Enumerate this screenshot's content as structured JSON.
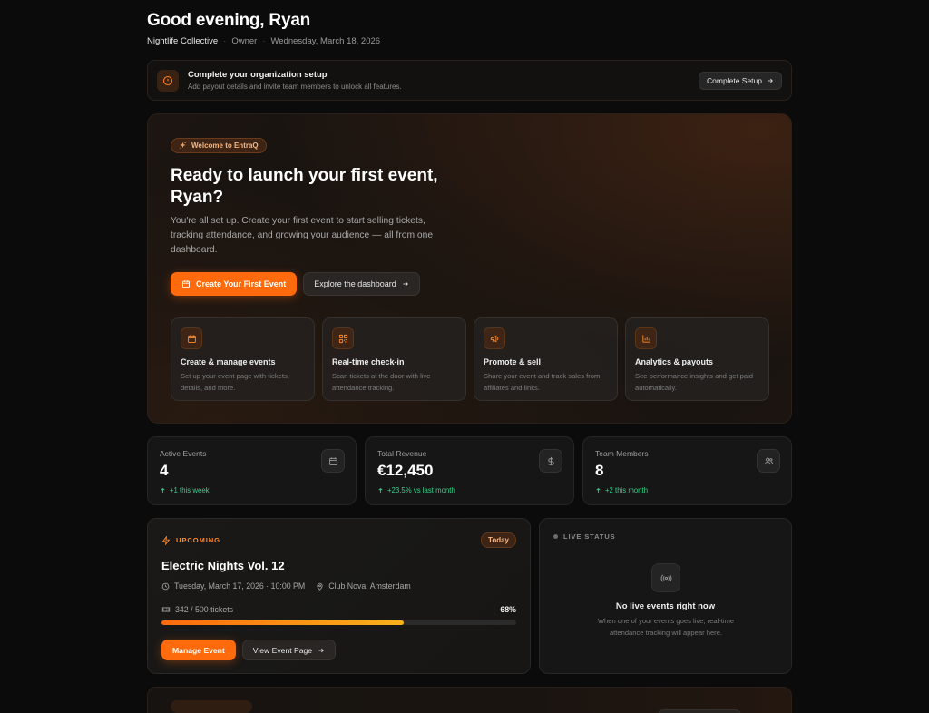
{
  "header": {
    "greeting": "Good evening, Ryan",
    "org": "Nightlife Collective",
    "role": "Owner",
    "date": "Wednesday, March 18, 2026"
  },
  "banner": {
    "title": "Complete your organization setup",
    "subtitle": "Add payout details and invite team members to unlock all features.",
    "button": "Complete Setup"
  },
  "hero": {
    "badge": "Welcome to EntraQ",
    "title": "Ready to launch your first event, Ryan?",
    "description": "You're all set up. Create your first event to start selling tickets, tracking attendance, and growing your audience — all from one dashboard.",
    "primary_button": "Create Your First Event",
    "secondary_button": "Explore the dashboard",
    "features": [
      {
        "icon": "calendar-icon",
        "title": "Create & manage events",
        "desc": "Set up your event page with tickets, details, and more."
      },
      {
        "icon": "qr-code-icon",
        "title": "Real-time check-in",
        "desc": "Scan tickets at the door with live attendance tracking."
      },
      {
        "icon": "megaphone-icon",
        "title": "Promote & sell",
        "desc": "Share your event and track sales from affiliates and links."
      },
      {
        "icon": "bar-chart-icon",
        "title": "Analytics & payouts",
        "desc": "See performance insights and get paid automatically."
      }
    ]
  },
  "stats": [
    {
      "label": "Active Events",
      "value": "4",
      "delta": "+1 this week",
      "icon": "calendar-icon"
    },
    {
      "label": "Total Revenue",
      "value": "€12,450",
      "delta": "+23.5% vs last month",
      "icon": "dollar-icon"
    },
    {
      "label": "Team Members",
      "value": "8",
      "delta": "+2 this month",
      "icon": "users-icon"
    }
  ],
  "event": {
    "kicker": "UPCOMING",
    "tag": "Today",
    "title": "Electric Nights Vol. 12",
    "datetime": "Tuesday, March 17, 2026 · 10:00 PM",
    "venue": "Club Nova, Amsterdam",
    "tickets": "342 / 500 tickets",
    "percent_label": "68%",
    "progress": 0.684,
    "primary_button": "Manage Event",
    "secondary_button": "View Event Page"
  },
  "live": {
    "kicker": "LIVE STATUS",
    "title": "No live events right now",
    "description": "When one of your events goes live, real-time attendance tracking will appear here."
  },
  "colors": {
    "accent": "#ff6a0d",
    "success": "#37d08a",
    "background": "#0b0b0b"
  }
}
